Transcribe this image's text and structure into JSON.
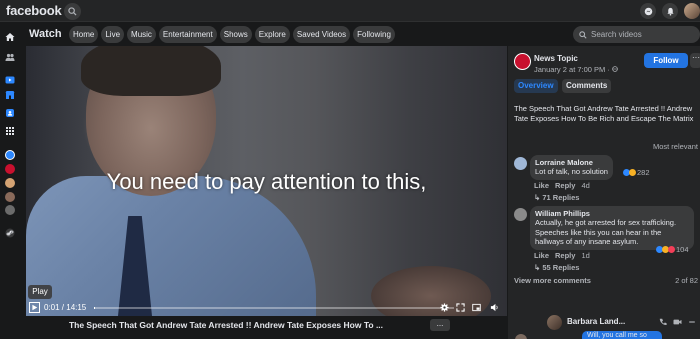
{
  "app": {
    "logo": "facebook"
  },
  "watch": {
    "title": "Watch",
    "nav": [
      "Home",
      "Live",
      "Music",
      "Entertainment",
      "Shows",
      "Explore",
      "Saved Videos",
      "Following"
    ],
    "search_placeholder": "Search videos"
  },
  "video": {
    "subtitle": "You need to pay attention to this,",
    "play_tooltip": "Play",
    "time": "0:01 / 14:15",
    "progress": 0.0012,
    "title": "The Speech That Got Andrew Tate Arrested !! Andrew Tate Exposes How To ...",
    "more_label": "..."
  },
  "panel": {
    "page_name": "News Topic",
    "date": "January 2 at 7:00 PM · ",
    "follow_label": "Follow",
    "more_label": "···",
    "tabs": [
      "Overview",
      "Comments"
    ],
    "description": "The Speech That Got Andrew Tate Arrested !! Andrew Tate Exposes How To Be Rich and Escape The Matrix",
    "sort_label": "Most relevant",
    "comments": [
      {
        "name": "Lorraine Malone",
        "text": "Lot of talk, no solution",
        "reactions": "282",
        "like": "Like",
        "reply": "Reply",
        "age": "4d",
        "replies": "71 Replies"
      },
      {
        "name": "William Phillips",
        "text": "Actually, he got arrested for sex trafficking. Speeches like this you can hear in the hallways of any insane asylum.",
        "reactions": "104",
        "like": "Like",
        "reply": "Reply",
        "age": "1d",
        "replies": "55 Replies"
      }
    ],
    "view_more": "View more comments",
    "count": "2 of 82"
  },
  "chat": {
    "name": "Barbara Land...",
    "peek": "Will, you call me so"
  },
  "colors": {
    "background": "#18191a",
    "surface": "#242526",
    "button": "#3a3b3c",
    "accent": "#2374e1",
    "news_red": "#c8102e"
  }
}
